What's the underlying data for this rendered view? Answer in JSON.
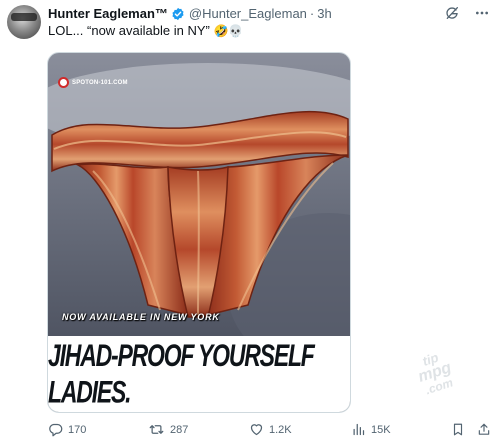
{
  "tweet": {
    "author_name": "Hunter Eagleman™",
    "handle": "@Hunter_Eagleman",
    "separator": "·",
    "time": "3h",
    "text": "LOL... “now available in NY”",
    "emojis": "🤣💀"
  },
  "media": {
    "logo_text": "SPOTON-101.COM",
    "caption": "NOW AVAILABLE IN NEW YORK",
    "banner": "JIHAD-PROOF YOURSELF LADIES."
  },
  "watermark": {
    "line1": "tip",
    "line2": "mpg",
    "line3": ".com"
  },
  "actions": {
    "replies": "170",
    "reposts": "287",
    "likes": "1.2K",
    "views": "15K"
  },
  "colors": {
    "text": "#0f1419",
    "secondary": "#536471",
    "verified": "#1d9bf0",
    "border": "#cfd9de",
    "bacon": "#b84a2c"
  },
  "icons": [
    "grok-icon",
    "more-icon",
    "reply-icon",
    "repost-icon",
    "like-icon",
    "views-icon",
    "bookmark-icon",
    "share-icon",
    "verified-badge-icon"
  ]
}
